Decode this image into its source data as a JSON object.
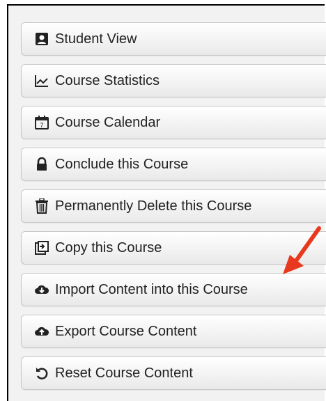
{
  "sidebar": {
    "items": [
      {
        "label": "Student View",
        "icon": "student-view-icon"
      },
      {
        "label": "Course Statistics",
        "icon": "line-chart-icon"
      },
      {
        "label": "Course Calendar",
        "icon": "calendar-icon"
      },
      {
        "label": "Conclude this Course",
        "icon": "lock-icon"
      },
      {
        "label": "Permanently Delete this Course",
        "icon": "trash-icon"
      },
      {
        "label": "Copy this Course",
        "icon": "copy-icon"
      },
      {
        "label": "Import Content into this Course",
        "icon": "cloud-download-icon"
      },
      {
        "label": "Export Course Content",
        "icon": "cloud-upload-icon"
      },
      {
        "label": "Reset Course Content",
        "icon": "reset-icon"
      }
    ]
  },
  "annotation": {
    "arrow_color": "#e8391e"
  }
}
